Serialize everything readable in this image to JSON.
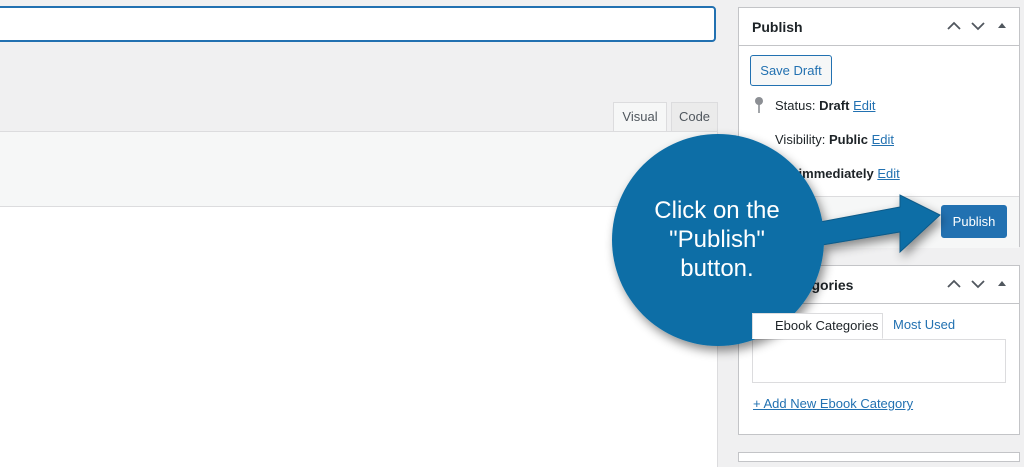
{
  "editor": {
    "title_value": "",
    "tabs": [
      {
        "label": "Visual"
      },
      {
        "label": "Code"
      }
    ]
  },
  "publish_box": {
    "title": "Publish",
    "save_draft_label": "Save Draft",
    "status_label": "Status:",
    "status_value": "Draft",
    "visibility_label": "Visibility:",
    "visibility_value": "Public",
    "schedule_partial_text": "h immediately",
    "edit_link": "Edit",
    "publish_label": "Publish"
  },
  "categories_box": {
    "title_partial": "tegories",
    "tab_all_partial": "Ebook Categories",
    "tab_most_used": "Most Used",
    "add_new_link": "+ Add New Ebook Category"
  },
  "callout": {
    "text_line1": "Click on the",
    "text_line2": "\"Publish\"",
    "text_line3": "button.",
    "color": "#0b6ea6"
  },
  "colors": {
    "accent": "#2271b1",
    "background": "#f0f0f1"
  }
}
